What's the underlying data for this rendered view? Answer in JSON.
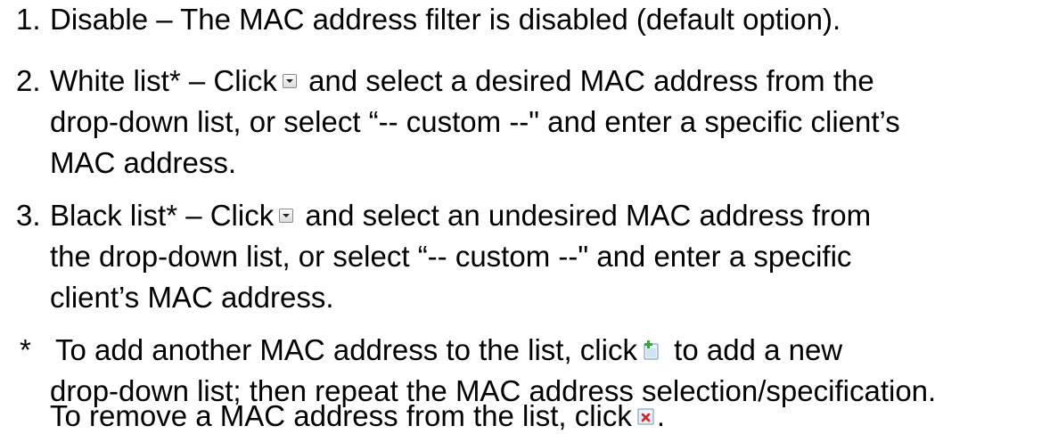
{
  "items": [
    {
      "number": "1.",
      "lines": [
        "Disable – The MAC address filter is disabled (default option)."
      ]
    },
    {
      "number": "2.",
      "line1_a": "White list* – Click",
      "line1_b": "and select a desired MAC address from the",
      "line2": "drop-down list, or select “-- custom --\" and enter a specific client’s",
      "line3": "MAC address."
    },
    {
      "number": "3.",
      "line1_a": "Black list* – Click",
      "line1_b": "and select an undesired MAC address from",
      "line2": "the drop-down list, or select “-- custom --\" and enter a specific",
      "line3": "client’s MAC address."
    }
  ],
  "note": {
    "marker": "*",
    "line1_a": "To add another MAC address to the list, click",
    "line1_b": "to add a new",
    "line2": "drop-down list; then repeat the MAC address selection/specification.",
    "line3_a": "To remove a MAC address from the list, click",
    "line3_b": "."
  },
  "icons": {
    "dropdown": "dropdown-arrow-icon",
    "add": "add-new-icon",
    "remove": "remove-icon"
  }
}
